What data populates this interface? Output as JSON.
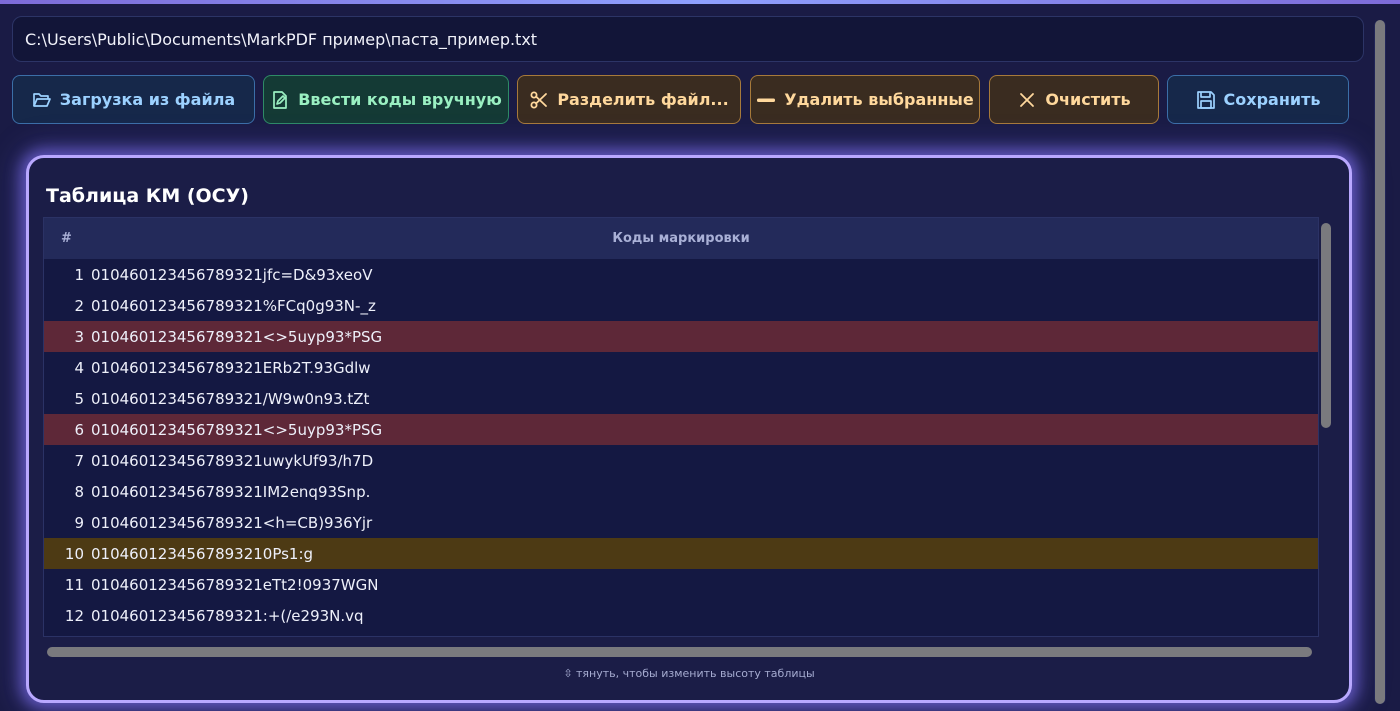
{
  "path": "C:\\Users\\Public\\Documents\\MarkPDF пример\\паста_пример.txt",
  "toolbar": {
    "load_label": "Загрузка из файла",
    "manual_label": "Ввести коды вручную",
    "split_label": "Разделить файл...",
    "delete_label": "Удалить выбранные",
    "clear_label": "Очистить",
    "save_label": "Сохранить"
  },
  "icons": {
    "load": "folder-open-icon",
    "manual": "edit-document-icon",
    "split": "scissors-icon",
    "delete": "minus-icon",
    "clear": "close-icon",
    "save": "floppy-disk-icon"
  },
  "panel": {
    "title": "Таблица КМ (ОСУ)",
    "resize_hint": "⇳ тянуть, чтобы изменить высоту таблицы"
  },
  "table": {
    "columns": [
      "#",
      "Коды маркировки"
    ],
    "rows": [
      {
        "num": "1",
        "code": "010460123456789321jfc=D&93xeoV",
        "status": "normal"
      },
      {
        "num": "2",
        "code": "010460123456789321%FCq0g93N-_z",
        "status": "normal"
      },
      {
        "num": "3",
        "code": "010460123456789321<>5uyp93*PSG",
        "status": "duplicate"
      },
      {
        "num": "4",
        "code": "010460123456789321ERb2T.93Gdlw",
        "status": "normal"
      },
      {
        "num": "5",
        "code": "010460123456789321/W9w0n93.tZt",
        "status": "normal"
      },
      {
        "num": "6",
        "code": "010460123456789321<>5uyp93*PSG",
        "status": "duplicate"
      },
      {
        "num": "7",
        "code": "010460123456789321uwykUf93/h7D",
        "status": "normal"
      },
      {
        "num": "8",
        "code": "010460123456789321IM2enq93Snp.",
        "status": "normal"
      },
      {
        "num": "9",
        "code": "010460123456789321<h=CB)936Yjr",
        "status": "normal"
      },
      {
        "num": "10",
        "code": "0104601234567893210Ps1:g",
        "status": "invalid"
      },
      {
        "num": "11",
        "code": "010460123456789321eTt2!0937WGN",
        "status": "normal"
      },
      {
        "num": "12",
        "code": "010460123456789321:+(/e293N.vq",
        "status": "normal"
      }
    ]
  },
  "colors": {
    "background": "#1a1b45",
    "duplicate_row": "#5e2838",
    "invalid_row": "#4d3a14",
    "panel_glow": "#b9a8ff"
  }
}
